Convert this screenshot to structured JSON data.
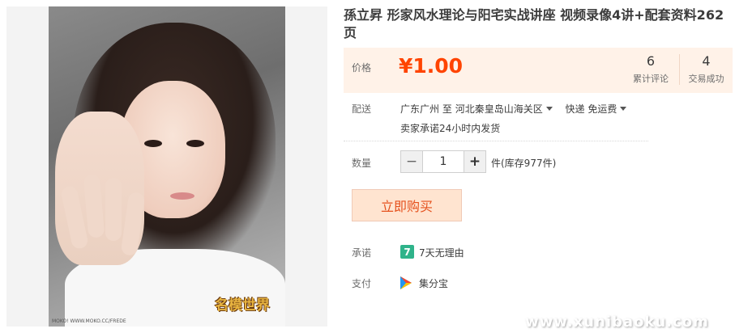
{
  "product": {
    "title": "孫立昇 形家风水理论与阳宅实战讲座 视频录像4讲+配套资料262页",
    "image_logo_text": "名模世界",
    "image_credit": "MOKO! WWW.MOKO.CC/FREDE"
  },
  "price": {
    "label": "价格",
    "value": "¥1.00",
    "reviews_count": "6",
    "reviews_label": "累计评论",
    "transactions_count": "4",
    "transactions_label": "交易成功"
  },
  "shipping": {
    "label": "配送",
    "from": "广东广州",
    "to_word": "至",
    "destination": "河北秦皇岛山海关区",
    "method": "快递 免运费",
    "note": "卖家承诺24小时内发货"
  },
  "quantity": {
    "label": "数量",
    "minus": "−",
    "value": "1",
    "plus": "+",
    "stock_text": "件(库存977件)"
  },
  "buy": {
    "label": "立即购买"
  },
  "promise": {
    "label": "承诺",
    "icon_text": "7",
    "text": "7天无理由"
  },
  "payment": {
    "label": "支付",
    "text": "集分宝"
  },
  "watermark": "www.xunibaoku.com",
  "colors": {
    "price": "#ff4400",
    "price_bg": "#fff2e8",
    "buy_bg": "#ffe4d0",
    "buy_text": "#e5511d",
    "promise_icon": "#2fb38a"
  }
}
